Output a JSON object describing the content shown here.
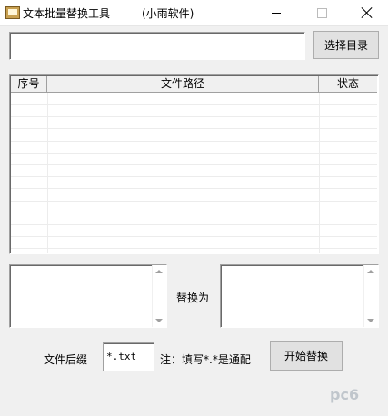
{
  "window": {
    "title": "文本批量替换工具",
    "subtitle": "(小雨软件)"
  },
  "toolbar": {
    "directory_value": "",
    "select_dir_label": "选择目录"
  },
  "file_list": {
    "columns": [
      "序号",
      "文件路径",
      "状态"
    ],
    "rows": []
  },
  "replace": {
    "find_value": "",
    "replace_label": "替换为",
    "replace_value": ""
  },
  "bottom": {
    "suffix_label": "文件后缀",
    "suffix_value": "*.txt",
    "note": "注：填写*.*是通配",
    "start_label": "开始替换"
  },
  "watermark": "pc6"
}
